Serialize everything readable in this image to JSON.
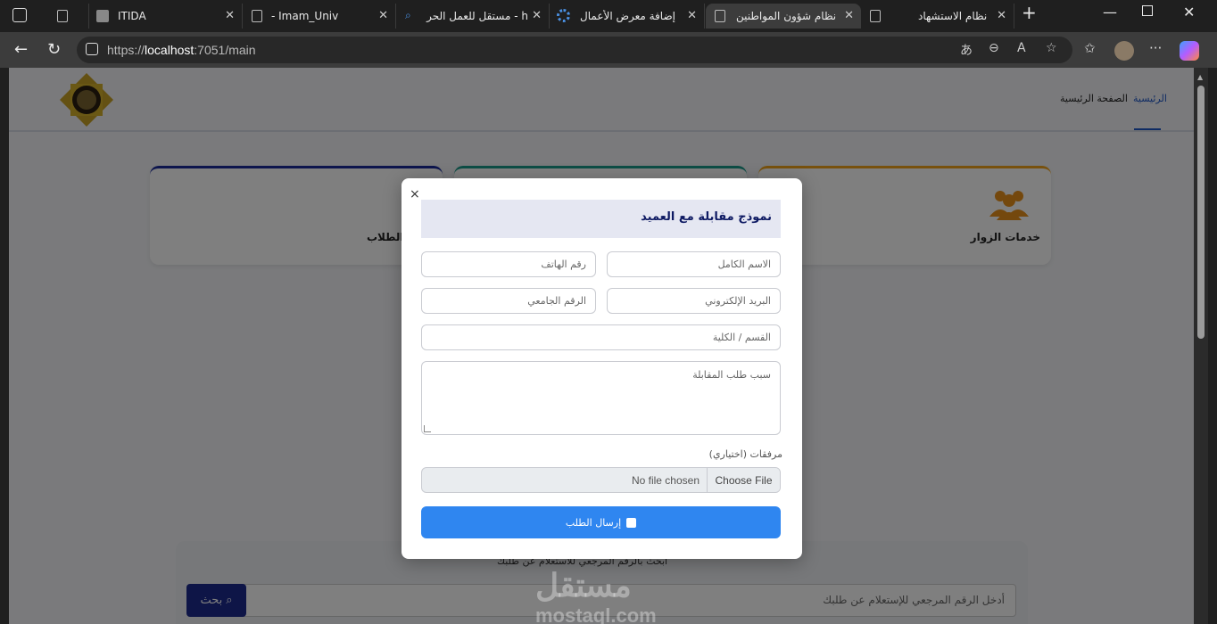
{
  "browser": {
    "tabs": [
      {
        "title": "",
        "active": false
      },
      {
        "title": "ITIDA",
        "active": false
      },
      {
        "title": "- Imam_Univ",
        "active": false
      },
      {
        "title": "مستقل للعمل الحر - h",
        "active": false
      },
      {
        "title": "إضافة معرض الأعمال",
        "active": false
      },
      {
        "title": "نظام شؤون المواطنين",
        "active": true
      },
      {
        "title": "نظام الاستشهاد",
        "active": false
      }
    ],
    "url_prefix": "https://",
    "url_host": "localhost",
    "url_rest": ":7051/main"
  },
  "page": {
    "nav": {
      "home": "الرئيسية",
      "main_page": "الصفحة الرئيسية"
    },
    "cards": [
      {
        "label": "خدمات الزوار",
        "color": "#f0a21a"
      },
      {
        "label": "",
        "color": "#1a9a8a"
      },
      {
        "label": "الطلاب",
        "color": "#1a2a9a"
      }
    ],
    "search": {
      "title": "ابحث بالرقم المرجعي للاستعلام عن طلبك",
      "placeholder": "أدخل الرقم المرجعي للإستعلام عن طلبك",
      "button": "بحث"
    }
  },
  "modal": {
    "title": "نموذج مقابلة مع العميد",
    "close": "×",
    "fields": {
      "full_name": "الاسم الكامل",
      "phone": "رقم الهاتف",
      "email": "البريد الإلكتروني",
      "university_id": "الرقم الجامعي",
      "department": "القسم / الكلية",
      "reason": "سبب طلب المقابلة"
    },
    "attachments_label": "مرفقات (اختياري)",
    "file": {
      "choose": "Choose File",
      "none": "No file chosen"
    },
    "submit": "إرسال الطلب",
    "accent": "#2f86f0"
  },
  "watermark": {
    "arabic": "مستقل",
    "domain": "mostaql.com"
  }
}
